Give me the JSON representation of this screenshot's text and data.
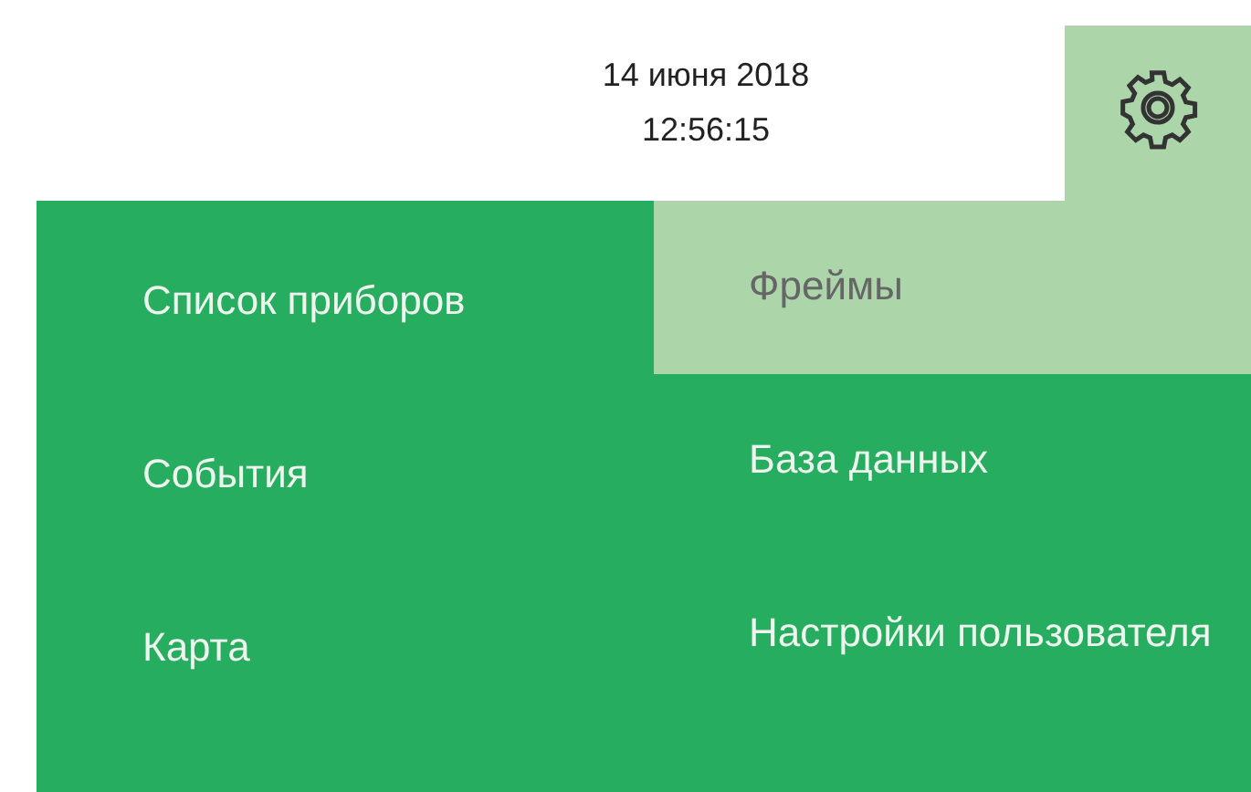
{
  "header": {
    "date": "14 июня 2018",
    "time": "12:56:15"
  },
  "menu": {
    "columns": [
      {
        "items": [
          {
            "label": "Список приборов",
            "selected": false
          },
          {
            "label": "События",
            "selected": false
          },
          {
            "label": "Карта",
            "selected": false
          }
        ]
      },
      {
        "items": [
          {
            "label": "Фреймы",
            "selected": true
          },
          {
            "label": "База данных",
            "selected": false
          },
          {
            "label": "Настройки пользователя",
            "selected": false
          }
        ]
      }
    ]
  }
}
